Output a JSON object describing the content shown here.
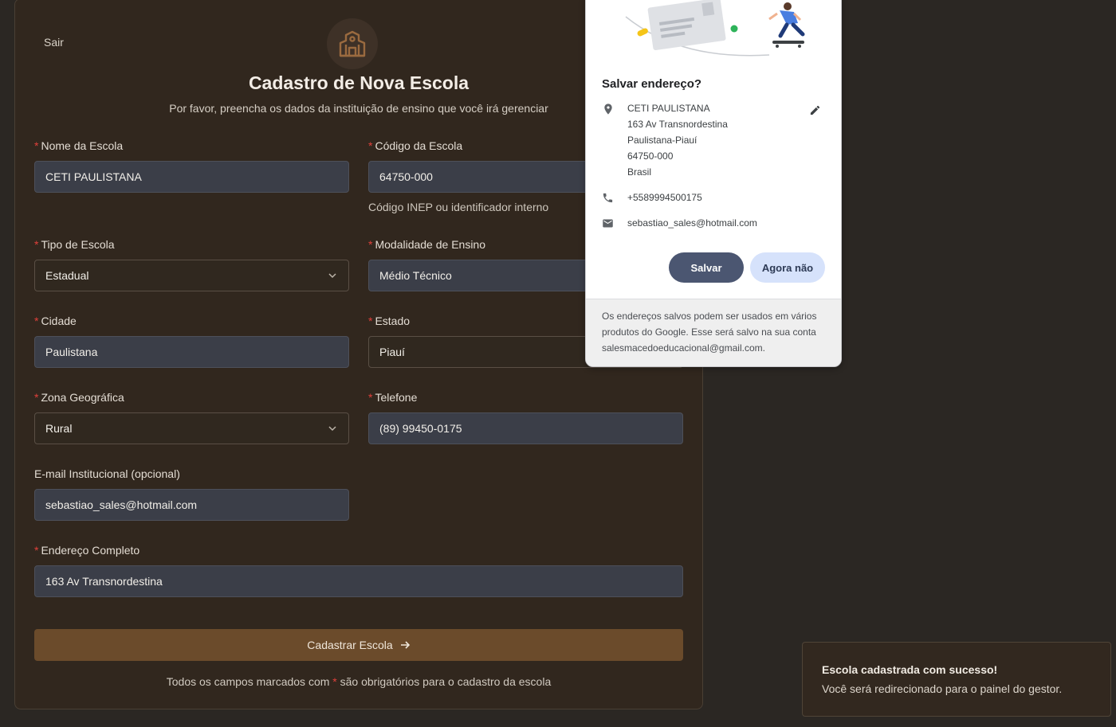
{
  "header": {
    "logout_label": "Sair",
    "title": "Cadastro de Nova Escola",
    "subtitle": "Por favor, preencha os dados da instituição de ensino que você irá gerenciar"
  },
  "form": {
    "school_name": {
      "label": "Nome da Escola",
      "value": "CETI PAULISTANA"
    },
    "school_code": {
      "label": "Código da Escola",
      "value": "64750-000",
      "hint": "Código INEP ou identificador interno"
    },
    "school_type": {
      "label": "Tipo de Escola",
      "value": "Estadual"
    },
    "teaching_mode": {
      "label": "Modalidade de Ensino",
      "value": "Médio Técnico"
    },
    "city": {
      "label": "Cidade",
      "value": "Paulistana"
    },
    "state": {
      "label": "Estado",
      "value": "Piauí"
    },
    "zone": {
      "label": "Zona Geográfica",
      "value": "Rural"
    },
    "phone": {
      "label": "Telefone",
      "value": "(89) 99450-0175"
    },
    "email": {
      "label": "E-mail Institucional (opcional)",
      "value": "sebastiao_sales@hotmail.com"
    },
    "address": {
      "label": "Endereço Completo",
      "value": "163 Av Transnordestina"
    },
    "required_mark": "*",
    "submit_label": "Cadastrar Escola",
    "footer_before": "Todos os campos marcados com ",
    "footer_after": " são obrigatórios para o cadastro da escola"
  },
  "save_address_popup": {
    "title": "Salvar endereço?",
    "address_lines": [
      "CETI PAULISTANA",
      "163 Av Transnordestina",
      "Paulistana-Piauí",
      "64750-000",
      "Brasil"
    ],
    "phone": "+5589994500175",
    "email": "sebastiao_sales@hotmail.com",
    "save_label": "Salvar",
    "not_now_label": "Agora não",
    "footer_text": "Os endereços salvos podem ser usados em vários produtos do Google. Esse será salvo na sua conta salesmacedoeducacional@gmail.com."
  },
  "toast": {
    "title": "Escola cadastrada com sucesso!",
    "message": "Você será redirecionado para o painel do gestor."
  },
  "icons": {
    "logo": "school-building-icon",
    "chevron": "chevron-down-icon",
    "arrow": "arrow-right-icon",
    "location": "location-pin-icon",
    "edit": "pencil-icon",
    "phone": "phone-icon",
    "email": "mail-icon"
  },
  "colors": {
    "accent": "#6b4b2b",
    "required": "#e0403b",
    "save_button": "#4b5671",
    "not_now_button": "#d6e2fb"
  }
}
